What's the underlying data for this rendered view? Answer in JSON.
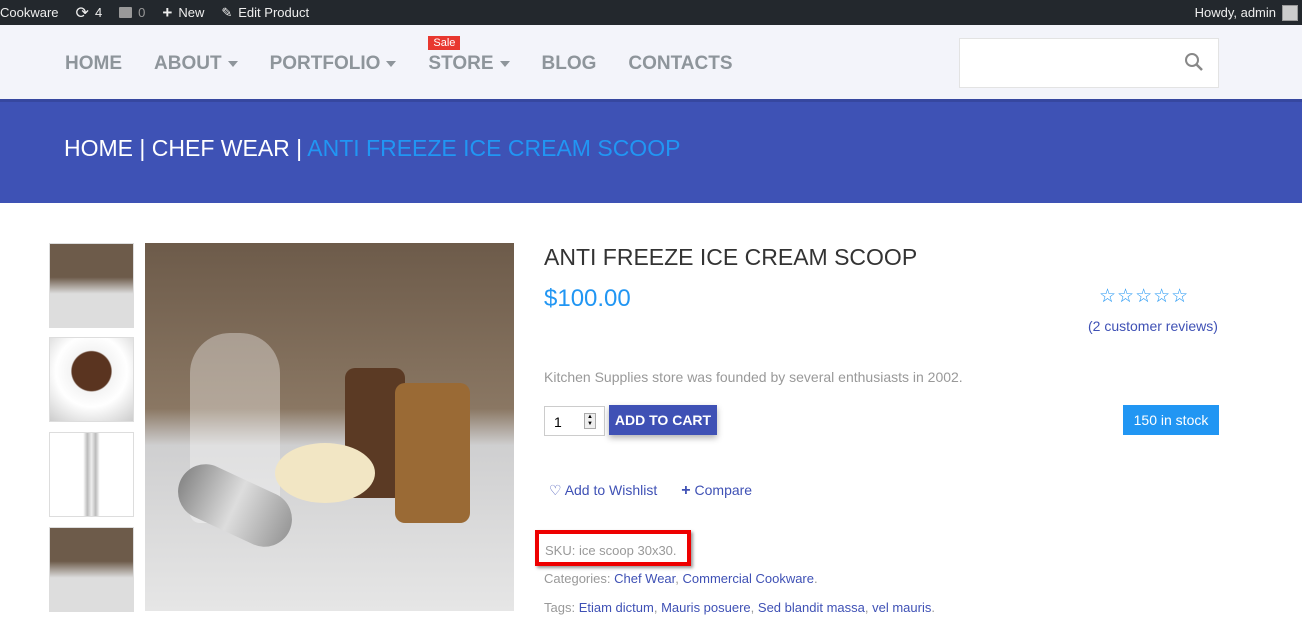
{
  "admin_bar": {
    "site": "Cookware",
    "updates": "4",
    "comments": "0",
    "new": "New",
    "edit": "Edit Product",
    "greeting": "Howdy, admin"
  },
  "nav": {
    "items": [
      {
        "label": "HOME"
      },
      {
        "label": "ABOUT",
        "dropdown": true
      },
      {
        "label": "PORTFOLIO",
        "dropdown": true
      },
      {
        "label": "STORE",
        "dropdown": true,
        "badge": "Sale"
      },
      {
        "label": "BLOG"
      },
      {
        "label": "CONTACTS"
      }
    ],
    "search_placeholder": ""
  },
  "breadcrumb": {
    "home": "HOME",
    "sep": " | ",
    "category": "CHEF WEAR",
    "current": "ANTI FREEZE ICE CREAM SCOOP"
  },
  "product": {
    "title": "ANTI FREEZE ICE CREAM SCOOP",
    "price": "$100.00",
    "rating": 0,
    "stars": "☆☆☆☆☆",
    "reviews": "(2 customer reviews)",
    "description": "Kitchen Supplies store was founded by several enthusiasts in 2002.",
    "quantity": "1",
    "add_to_cart": "ADD TO CART",
    "stock": "150 in stock",
    "wishlist": "Add to Wishlist",
    "compare": "Compare",
    "sku": "SKU: ice scoop 30x30.",
    "categories_label": "Categories: ",
    "categories": [
      "Chef Wear",
      "Commercial Cookware"
    ],
    "tags_label": "Tags: ",
    "tags": [
      "Etiam dictum",
      "Mauris posuere",
      "Sed blandit massa",
      "vel mauris"
    ],
    "sep": ", ",
    "end": "."
  },
  "colors": {
    "primary": "#3f51b5",
    "accent": "#2196f3",
    "sale": "#e8372f",
    "highlight": "#ee0000"
  }
}
